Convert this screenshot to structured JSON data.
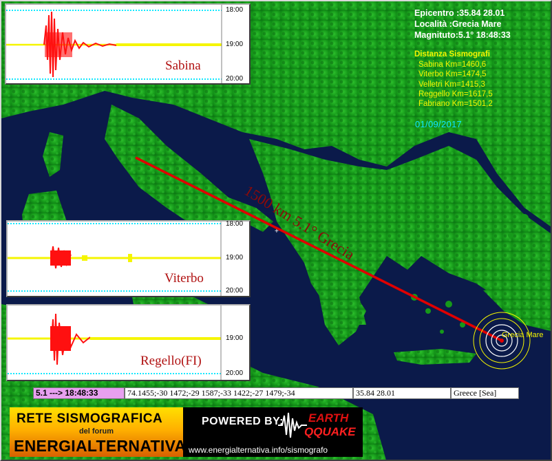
{
  "info": {
    "epicentro": "Epicentro :35.84 28.01",
    "localita": "Località :Grecia Mare",
    "magnituto": "Magnituto:5.1° 18:48:33"
  },
  "distanze": {
    "title": "Distanza Sismografi",
    "items": [
      "Sabina Km=1460,6",
      "Viterbo Km=1474,5",
      "Velletri Km=1415,3",
      "Reggello Km=1617,5",
      "Fabriano Km=1501,2"
    ]
  },
  "date": "01/09/2017",
  "line_label": "1500 km 5.1° Grecia",
  "epicenter_label": "Grecia Mare",
  "seismographs": [
    {
      "name": "Sabina",
      "times": [
        "18:00",
        "19:00",
        "20:00"
      ]
    },
    {
      "name": "Viterbo",
      "times": [
        "18:00",
        "19:00",
        "20:00"
      ]
    },
    {
      "name": "Regello(FI)",
      "times": [
        "",
        "19:00",
        "20:00"
      ]
    }
  ],
  "status_bar": {
    "magnitude_time": "5.1 ---> 18:48:33",
    "coords_list": "74.1455;-30 1472;-29 1587;-33 1422;-27 1479;-34",
    "epicenter_coords": "35.84 28.01",
    "region": "Greece [Sea]"
  },
  "banner": {
    "rete": "RETE SISMOGRAFICA",
    "forum": "del forum",
    "energ": "ENERGIALTERNATIVA",
    "powered": "POWERED BY:",
    "logo_earth": "EARTH",
    "logo_quake": "QQUAKE",
    "url": "www.energialternativa.info/sismografo"
  },
  "colors": {
    "trace": "#f5f500",
    "event": "#ff1010",
    "grid": "#10e8ff",
    "line": "#e00000",
    "sea": "#0b1a4a",
    "land": "#1aa81a"
  }
}
